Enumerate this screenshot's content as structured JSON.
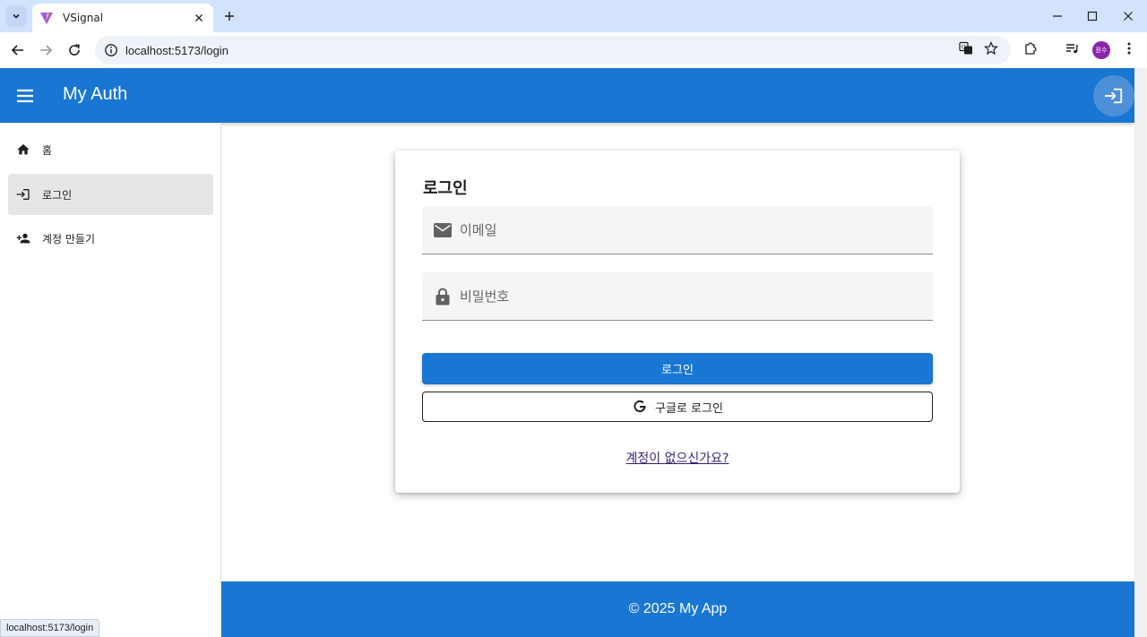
{
  "browser": {
    "tab_title": "VSignal",
    "url": "localhost:5173/login",
    "profile_initials": "원수",
    "status_url": "localhost:5173/login"
  },
  "appbar": {
    "title": "My Auth"
  },
  "sidebar": {
    "items": [
      {
        "label": "홈",
        "icon": "home-icon"
      },
      {
        "label": "로그인",
        "icon": "login-icon",
        "active": true
      },
      {
        "label": "계정 만들기",
        "icon": "person-add-icon"
      }
    ]
  },
  "login_card": {
    "title": "로그인",
    "email_placeholder": "이메일",
    "password_placeholder": "비밀번호",
    "login_button": "로그인",
    "google_button": "구글로 로그인",
    "signup_link": "계정이 없으신가요?"
  },
  "footer": {
    "text": "© 2025 My App"
  },
  "colors": {
    "primary": "#1976d2",
    "tabstrip": "#d3e3fd",
    "active_nav": "#e6e6e6"
  }
}
